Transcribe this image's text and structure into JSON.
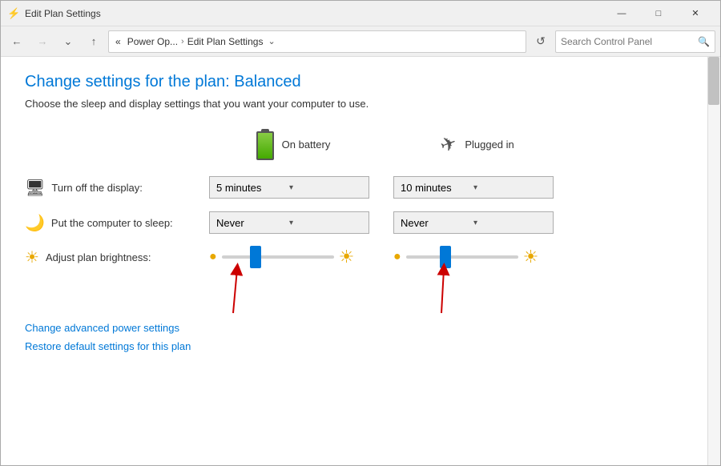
{
  "titlebar": {
    "title": "Edit Plan Settings",
    "icon": "⚡",
    "min_btn": "—",
    "max_btn": "□",
    "close_btn": "✕"
  },
  "addressbar": {
    "back_btn": "←",
    "forward_btn": "→",
    "dropdown_btn": "⌄",
    "up_btn": "↑",
    "breadcrumb_prefix": "«",
    "breadcrumb_parent": "Power Op...",
    "breadcrumb_sep": "›",
    "breadcrumb_current": "Edit Plan Settings",
    "breadcrumb_arrow": "⌄",
    "refresh_btn": "↺",
    "search_placeholder": "Search Control Panel",
    "search_icon": "🔍"
  },
  "main": {
    "page_title": "Change settings for the plan: Balanced",
    "page_desc": "Choose the sleep and display settings that you want your computer to use.",
    "col_battery": "On battery",
    "col_plugged": "Plugged in",
    "rows": [
      {
        "label": "Turn off the display:",
        "battery_value": "5 minutes",
        "plugged_value": "10 minutes"
      },
      {
        "label": "Put the computer to sleep:",
        "battery_value": "Never",
        "plugged_value": "Never"
      },
      {
        "label": "Adjust plan brightness:"
      }
    ],
    "links": [
      "Change advanced power settings",
      "Restore default settings for this plan"
    ]
  }
}
